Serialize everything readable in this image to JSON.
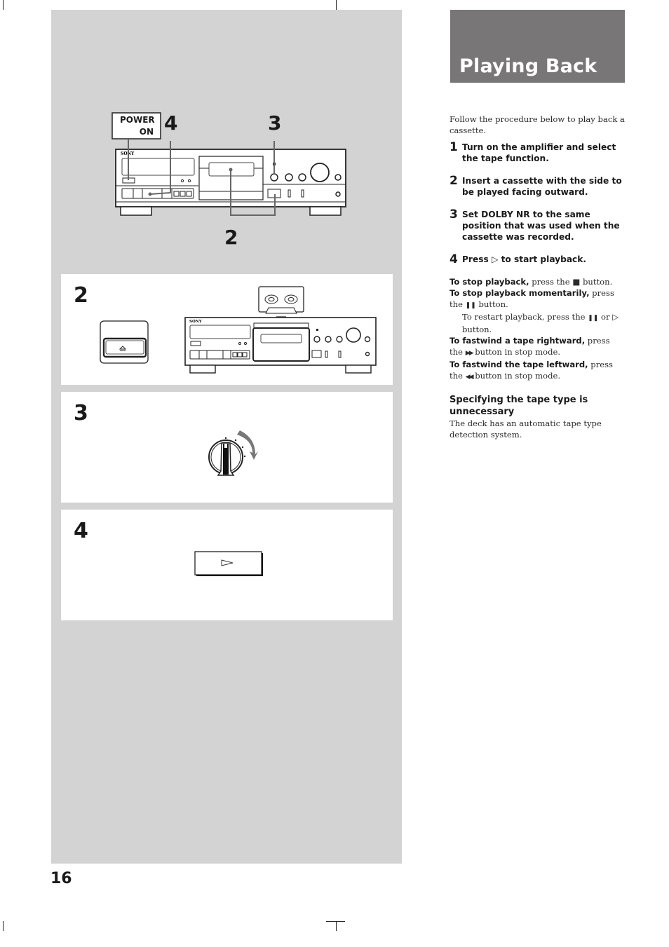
{
  "page": {
    "number": "16",
    "title": "Playing Back"
  },
  "overview_figure": {
    "power_label_line1": "POWER",
    "power_label_line2": "ON",
    "callouts": [
      "4",
      "3",
      "2"
    ],
    "brand": "SONY"
  },
  "panels": [
    {
      "step": "2",
      "figure": "eject-button-and-cassette-insertion",
      "brand": "SONY"
    },
    {
      "step": "3",
      "figure": "dolby-nr-knob"
    },
    {
      "step": "4",
      "figure": "play-button"
    }
  ],
  "content": {
    "intro": "Follow the procedure below to play back a cassette.",
    "steps": [
      {
        "n": "1",
        "text": "Turn on the amplifier and select the tape function."
      },
      {
        "n": "2",
        "text": "Insert a cassette with the side to be played facing outward."
      },
      {
        "n": "3",
        "text": "Set DOLBY NR to the same position that was used when the cassette was recorded."
      },
      {
        "n": "4",
        "text_before": "Press ",
        "icon": "play-icon",
        "text_after": " to start playback."
      }
    ],
    "notes": [
      {
        "bold": "To stop playback,",
        "rest_before": " press the ",
        "icon": "stop-icon",
        "rest_after": " button."
      },
      {
        "bold": "To stop playback momentarily,",
        "rest_before": " press the ",
        "icon": "pause-icon",
        "rest_after": " button."
      },
      {
        "indent_before": "To restart playback, press the ",
        "icon1": "pause-icon",
        "indent_mid": " or ",
        "icon2": "play-icon",
        "indent_after": " button."
      },
      {
        "bold": "To fastwind a tape rightward,",
        "rest_before": " press the ",
        "icon": "fast-forward-icon",
        "rest_after": " button in stop mode."
      },
      {
        "bold": "To fastwind the tape leftward,",
        "rest_before": " press the ",
        "icon": "rewind-icon",
        "rest_after": " button in stop mode."
      }
    ],
    "subheading": "Specifying the tape type is unnecessary",
    "subtext": "The deck has an automatic tape type detection system."
  },
  "glyphs": {
    "play": "▷",
    "stop": "■",
    "pause": "❚❚",
    "ff": "▶▶",
    "rew": "◀◀",
    "eject": "⏏"
  }
}
